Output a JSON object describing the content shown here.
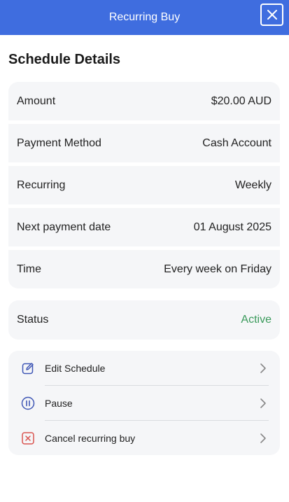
{
  "header": {
    "title": "Recurring Buy",
    "close_icon": "close-icon"
  },
  "section": {
    "title": "Schedule Details"
  },
  "details": [
    {
      "label": "Amount",
      "value": "$20.00 AUD"
    },
    {
      "label": "Payment Method",
      "value": "Cash Account"
    },
    {
      "label": "Recurring",
      "value": "Weekly"
    },
    {
      "label": "Next payment date",
      "value": "01 August 2025"
    },
    {
      "label": "Time",
      "value": "Every week on Friday"
    }
  ],
  "status": {
    "label": "Status",
    "value": "Active",
    "color": "#3a9a5b"
  },
  "actions": [
    {
      "label": "Edit Schedule",
      "icon": "edit-icon"
    },
    {
      "label": "Pause",
      "icon": "pause-icon"
    },
    {
      "label": "Cancel recurring buy",
      "icon": "cancel-icon"
    }
  ],
  "colors": {
    "header_bg": "#3f6ddf",
    "card_bg": "#f5f6f8",
    "icon_blue": "#3f57b5",
    "icon_red": "#d9534f"
  }
}
